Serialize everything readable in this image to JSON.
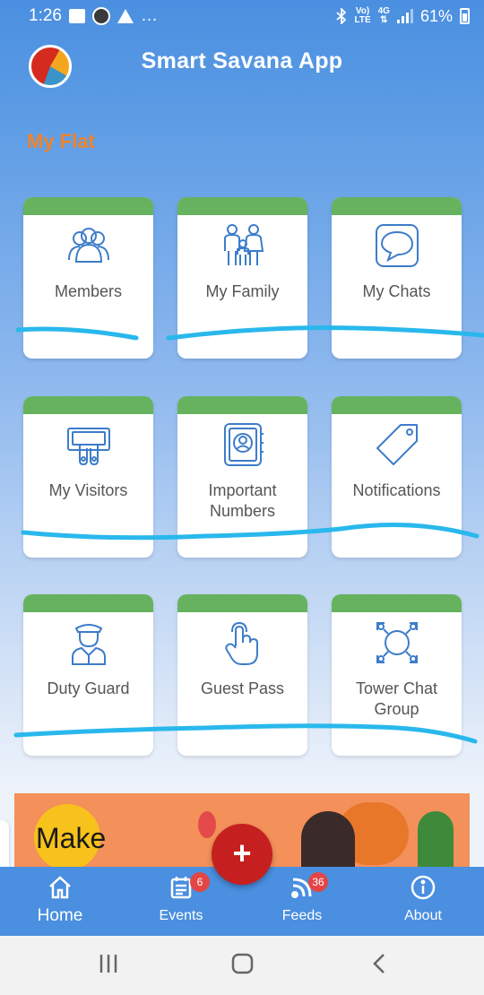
{
  "status_bar": {
    "time": "1:26",
    "dots": "…",
    "network_top": "Vo)",
    "network_bottom": "LTE",
    "data_top": "4G",
    "data_bottom": "⇅",
    "battery": "61%"
  },
  "header": {
    "title": "Smart Savana App",
    "avatar_icon": "app-logo"
  },
  "section": {
    "title": "My Flat"
  },
  "tiles": [
    {
      "label": "Members",
      "icon": "members-icon"
    },
    {
      "label": "My Family",
      "icon": "family-icon"
    },
    {
      "label": "My Chats",
      "icon": "chat-icon"
    },
    {
      "label": "My Visitors",
      "icon": "visitors-icon"
    },
    {
      "label": "Important\nNumbers",
      "icon": "contact-book-icon"
    },
    {
      "label": "Notifications",
      "icon": "tag-icon"
    },
    {
      "label": "Duty  Guard",
      "icon": "guard-icon"
    },
    {
      "label": "Guest Pass",
      "icon": "tap-hand-icon"
    },
    {
      "label": "Tower Chat\nGroup",
      "icon": "group-icon"
    }
  ],
  "banner": {
    "text": "Make"
  },
  "fab": {
    "label": "+"
  },
  "bottom_nav": {
    "items": [
      {
        "label": "Home",
        "icon": "home-icon",
        "active": true
      },
      {
        "label": "Events",
        "icon": "events-icon",
        "badge": "6"
      },
      {
        "label": "Feeds",
        "icon": "rss-icon",
        "badge": "36"
      },
      {
        "label": "About",
        "icon": "info-icon"
      }
    ]
  },
  "colors": {
    "primary": "#4a8fe0",
    "accent": "#f0832a",
    "tile_strip": "#66b25f",
    "icon_stroke": "#3d7cc9",
    "fab": "#c5201f",
    "badge": "#e34545",
    "scribble": "#29b8ec"
  }
}
